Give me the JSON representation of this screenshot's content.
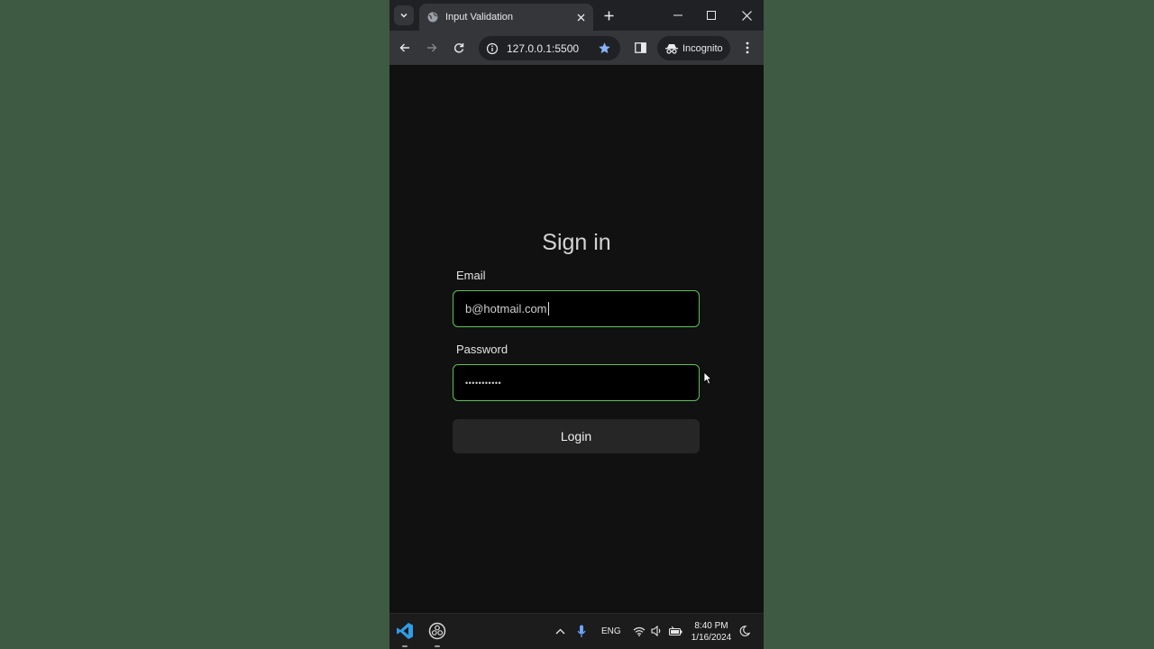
{
  "browser": {
    "tab_title": "Input Validation",
    "url": "127.0.0.1:5500",
    "incognito_label": "Incognito",
    "icons": [
      "tab-search-icon",
      "globe-icon",
      "close-icon",
      "plus-icon",
      "minimize-icon",
      "maximize-icon",
      "back-icon",
      "forward-icon",
      "reload-icon",
      "info-icon",
      "star-icon",
      "side-panel-icon",
      "incognito-icon",
      "kebab-menu-icon"
    ]
  },
  "form": {
    "title": "Sign in",
    "email_label": "Email",
    "email_value": "b@hotmail.com",
    "password_label": "Password",
    "password_value": "•••••••••••",
    "login_label": "Login",
    "border_color": "#5fbf5a"
  },
  "taskbar": {
    "lang": "ENG",
    "time": "8:40 PM",
    "date": "1/16/2024",
    "icons": [
      "vscode-icon",
      "obs-icon",
      "chevron-up-icon",
      "microphone-icon",
      "wifi-icon",
      "speaker-icon",
      "battery-icon",
      "moon-icon"
    ]
  }
}
